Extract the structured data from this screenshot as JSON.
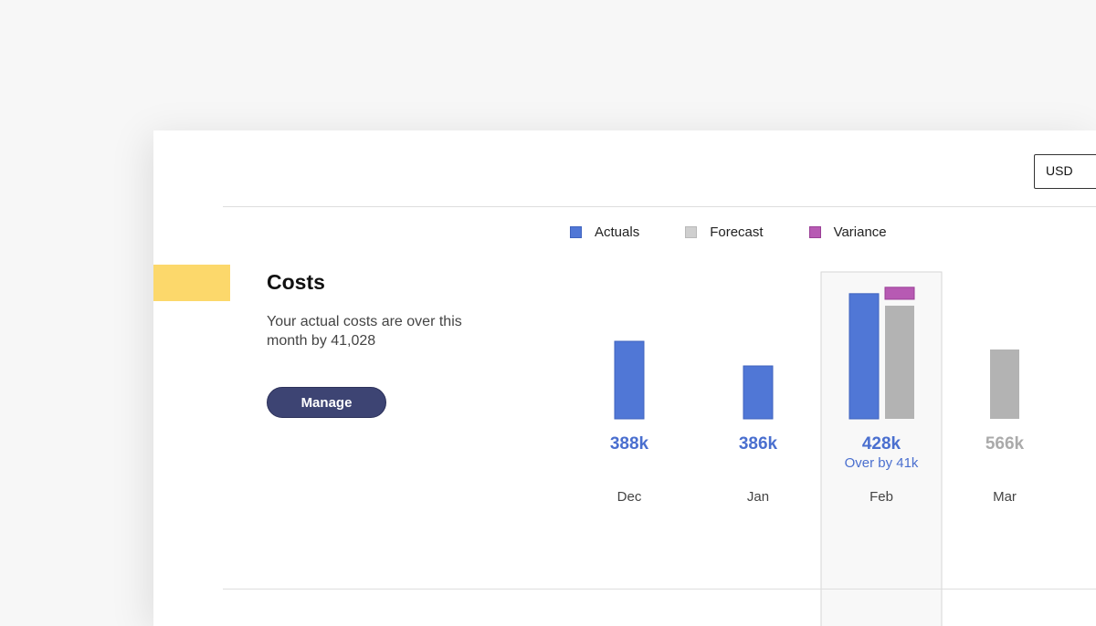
{
  "currency": {
    "selected": "USD"
  },
  "section": {
    "title": "Costs",
    "description": "Your actual costs are over this month by 41,028",
    "button_label": "Manage"
  },
  "colors": {
    "actuals": "#5077d6",
    "forecast": "#b3b3b3",
    "variance": "#b75ab3",
    "accent": "#fcd86b",
    "button": "#3d4473",
    "value_label": "#4a6fcf",
    "forecast_label": "#aaaaaa"
  },
  "chart_data": {
    "type": "bar",
    "legend": [
      "Actuals",
      "Forecast",
      "Variance"
    ],
    "legend_position": "top",
    "categories": [
      "Dec",
      "Jan",
      "Feb",
      "Mar"
    ],
    "series": [
      {
        "name": "Actuals",
        "values": [
          388,
          386,
          428,
          null
        ]
      },
      {
        "name": "Forecast",
        "values": [
          null,
          null,
          387,
          566
        ]
      },
      {
        "name": "Variance",
        "values": [
          null,
          null,
          41,
          null
        ]
      }
    ],
    "value_labels": [
      "388k",
      "386k",
      "428k",
      "566k"
    ],
    "value_label_series": [
      "Actuals",
      "Actuals",
      "Actuals",
      "Forecast"
    ],
    "annotations": [
      {
        "category": "Feb",
        "text": "Over by 41k"
      }
    ],
    "highlighted_category": "Feb",
    "grid": false
  }
}
